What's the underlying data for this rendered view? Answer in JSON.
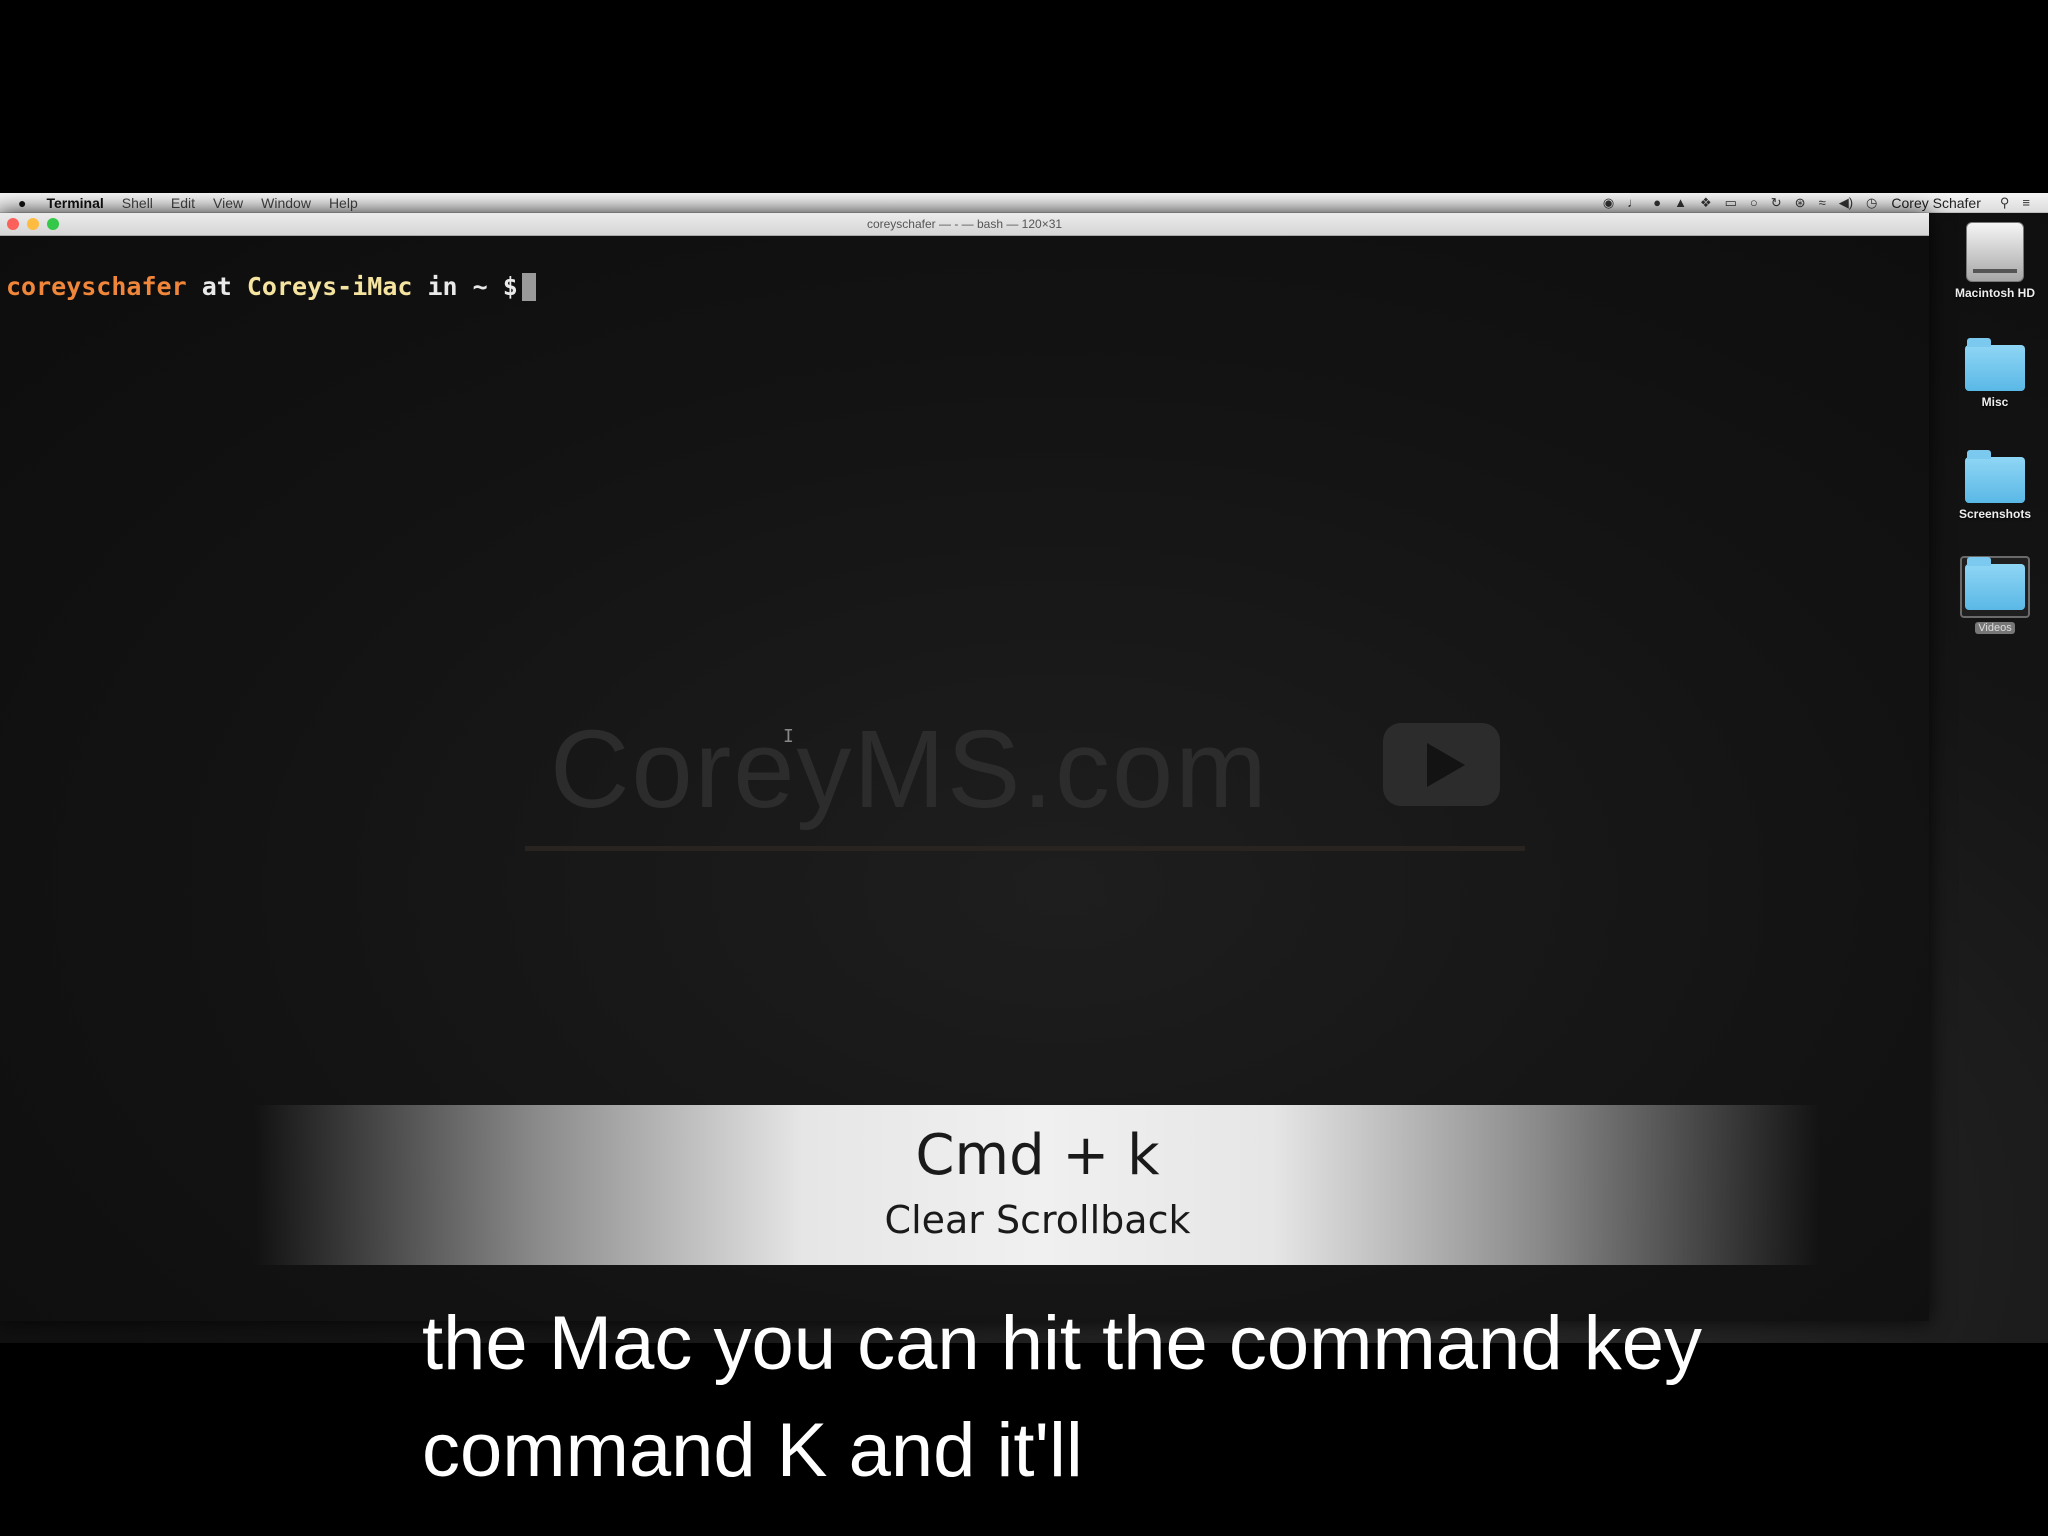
{
  "menubar": {
    "apple_icon": "apple-icon",
    "app_name": "Terminal",
    "menus": [
      "Shell",
      "Edit",
      "View",
      "Window",
      "Help"
    ],
    "status_icons": [
      "screen-record-icon",
      "bell-icon",
      "chat-icon",
      "drive-icon",
      "dropbox-icon",
      "airplay-icon",
      "bubble-icon",
      "time-machine-icon",
      "bluetooth-icon",
      "wifi-icon",
      "volume-icon",
      "clock-icon"
    ],
    "user": "Corey Schafer",
    "spotlight_icon": "search-icon",
    "notifications_icon": "list-icon"
  },
  "window": {
    "title": "coreyschafer — -  — bash — 120×31"
  },
  "terminal": {
    "user": "coreyschafer",
    "at": "at",
    "host": "Coreys-iMac",
    "in": "in",
    "dir": "~",
    "symbol": "$"
  },
  "watermark": {
    "text": "CoreyMS.com"
  },
  "banner": {
    "shortcut": "Cmd + k",
    "description": "Clear Scrollback"
  },
  "desktop_icons": [
    "Macintosh HD",
    "Misc",
    "Screenshots",
    "Videos"
  ],
  "captions": {
    "line1": "the Mac you can hit the command key",
    "line2": "command K and it'll"
  }
}
